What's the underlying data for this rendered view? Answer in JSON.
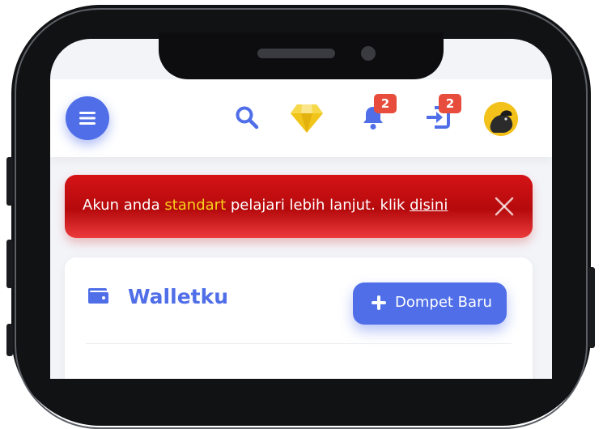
{
  "header": {
    "badges": {
      "notifications": "2",
      "inbox": "2"
    },
    "icons": [
      "menu-icon",
      "search-icon",
      "diamond-icon",
      "bell-icon",
      "login-icon",
      "avatar"
    ]
  },
  "alert": {
    "text_before": "Akun anda ",
    "highlight": "standart",
    "text_after": " pelajari lebih lanjut. klik ",
    "link": "disini"
  },
  "wallet": {
    "title": "Walletku",
    "new_button": "Dompet Baru"
  },
  "colors": {
    "primary": "#4f6ee8",
    "alert_red": "#c80d10",
    "highlight_yellow": "#f7d31b",
    "badge_red": "#e74c3c",
    "diamond_gold": "#f0c419"
  }
}
